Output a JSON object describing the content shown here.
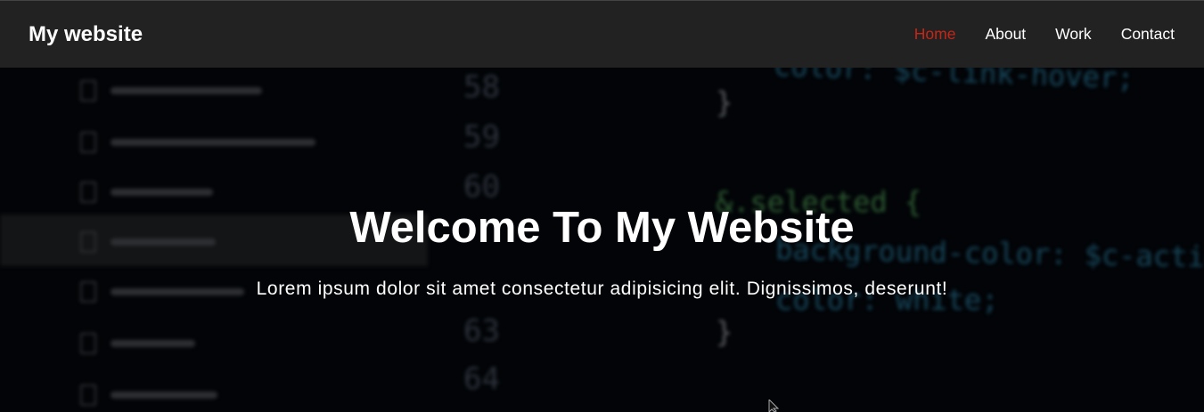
{
  "header": {
    "brand": "My website",
    "nav": [
      {
        "label": "Home",
        "active": true
      },
      {
        "label": "About",
        "active": false
      },
      {
        "label": "Work",
        "active": false
      },
      {
        "label": "Contact",
        "active": false
      }
    ]
  },
  "hero": {
    "title": "Welcome To My Website",
    "subtitle": "Lorem ipsum dolor sit amet consectetur adipisicing elit. Dignissimos, deserunt!"
  },
  "background_code": {
    "line_numbers": [
      "58",
      "59",
      "60",
      "63",
      "64"
    ],
    "lines": [
      "color: $c-link-hover;",
      "}",
      "&.selected {",
      "background-color: $c-action;",
      "color: white;",
      "}"
    ]
  },
  "colors": {
    "navbar_bg": "#222222",
    "active_link": "#c72617",
    "text": "#ffffff"
  }
}
